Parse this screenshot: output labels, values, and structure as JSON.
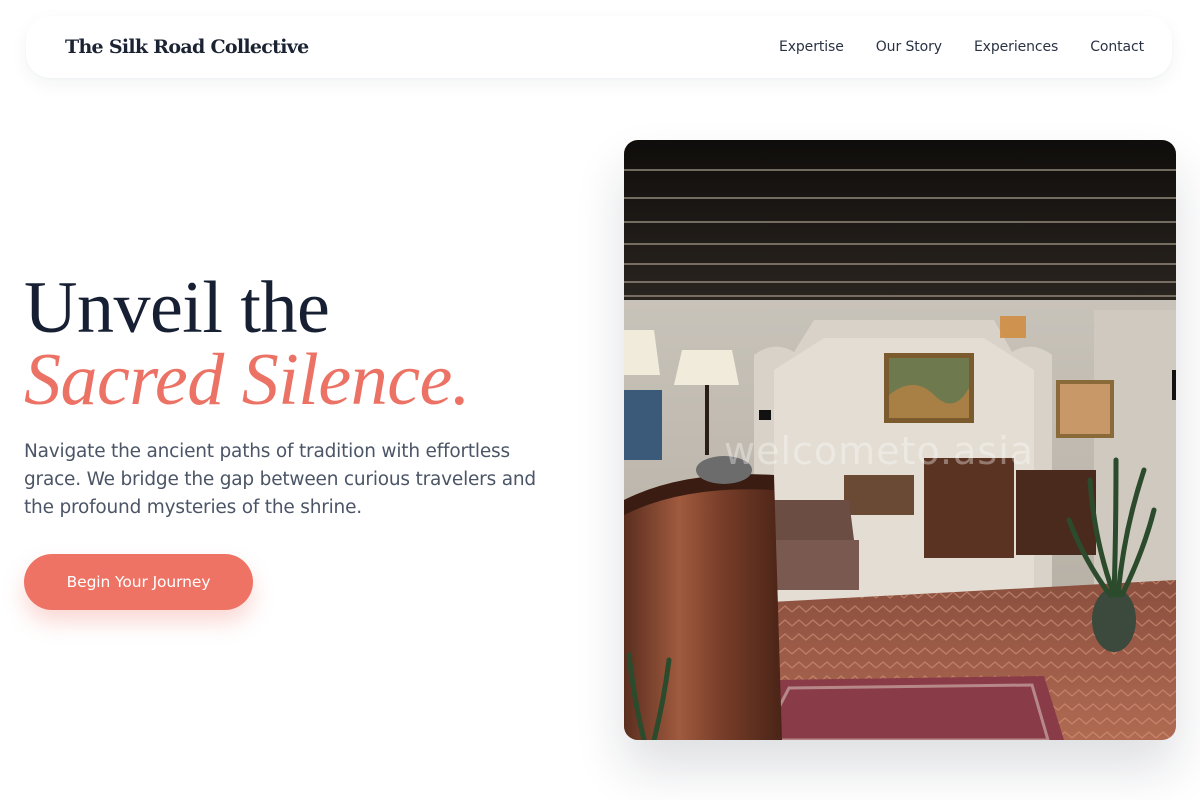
{
  "brand": {
    "name": "The Silk Road Collective"
  },
  "nav": {
    "items": [
      {
        "label": "Expertise"
      },
      {
        "label": "Our Story"
      },
      {
        "label": "Experiences"
      },
      {
        "label": "Contact"
      }
    ]
  },
  "hero": {
    "title_line1": "Unveil the",
    "title_line2": "Sacred Silence.",
    "description": "Navigate the ancient paths of tradition with effortless grace. We bridge the gap between curious travelers and the profound mysteries of the shrine.",
    "cta_label": "Begin Your Journey",
    "image": {
      "watermark": "welcometo.asia"
    }
  },
  "colors": {
    "accent": "#ee7365",
    "heading": "#172033",
    "body_text": "#4b5566",
    "background": "#ffffff"
  }
}
